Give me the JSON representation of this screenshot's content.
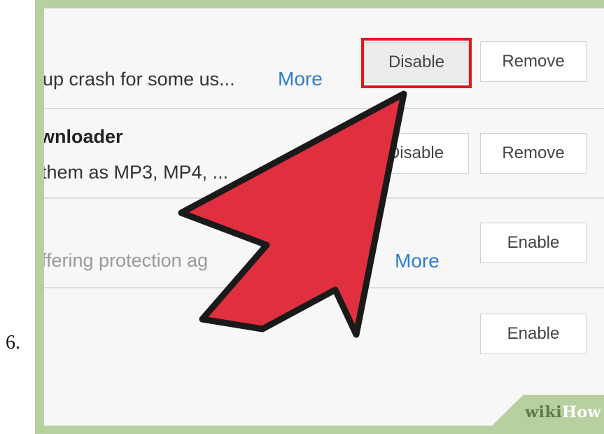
{
  "step_number": "6.",
  "extensions": [
    {
      "description": "up crash for some us...",
      "more_label": "More",
      "disable_label": "Disable",
      "remove_label": "Remove"
    },
    {
      "title": "wnloader",
      "description": "them as MP3, MP4, ...",
      "disable_label": "Disable",
      "remove_label": "Remove"
    },
    {
      "description": "ffering protection ag",
      "more_label": "More",
      "enable_label": "Enable"
    },
    {
      "enable_label": "Enable"
    }
  ],
  "watermark": {
    "wiki": "wiki",
    "how": "How"
  },
  "colors": {
    "frame": "#b8cfa0",
    "arrow_fill": "#e03040",
    "arrow_stroke": "#1a1a1a",
    "highlight": "#e0181d",
    "link": "#2d7fd0"
  },
  "icons": {
    "pointer": "arrow-pointer-icon"
  }
}
